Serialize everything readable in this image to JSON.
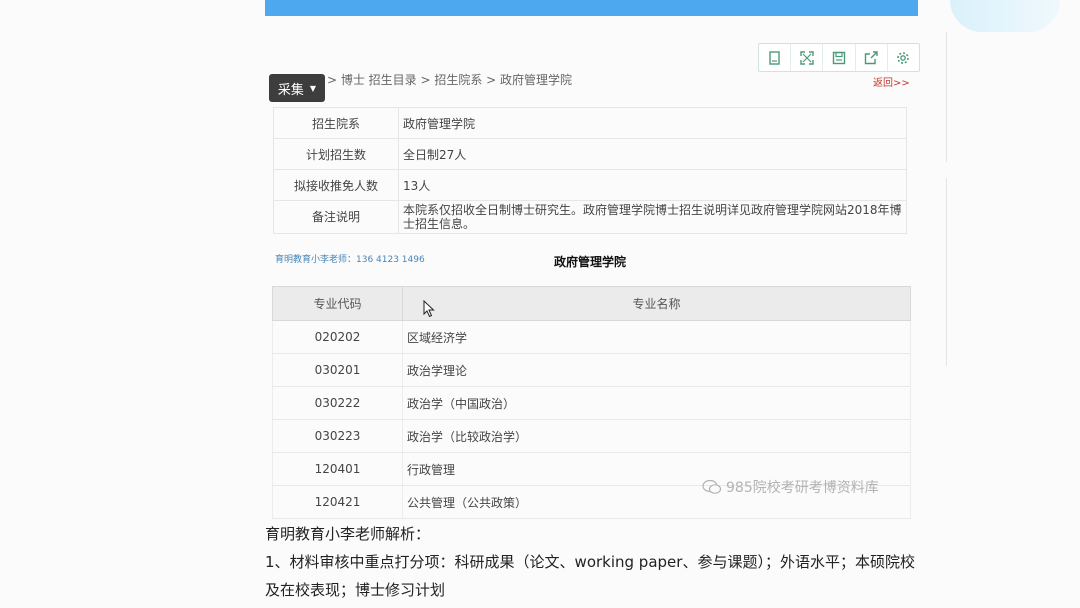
{
  "toolbar": {
    "icons": [
      "bookmark-icon",
      "fullscreen-icon",
      "save-icon",
      "share-icon",
      "gear-icon"
    ]
  },
  "collect_button": {
    "label": "采集"
  },
  "breadcrumb": "> 博士 招生目录 > 招生院系 >  政府管理学院",
  "return_link": "返回>>",
  "info_table": [
    {
      "label": "招生院系",
      "value": "政府管理学院"
    },
    {
      "label": "计划招生数",
      "value": "全日制27人"
    },
    {
      "label": "拟接收推免人数",
      "value": "13人"
    },
    {
      "label": "备注说明",
      "value": "本院系仅招收全日制博士研究生。政府管理学院博士招生说明详见政府管理学院网站2018年博士招生信息。"
    }
  ],
  "watermark_left": "育明教育小李老师：136 4123 1496",
  "section_title": "政府管理学院",
  "major_table": {
    "headers": {
      "code": "专业代码",
      "name": "专业名称"
    },
    "rows": [
      {
        "code": "020202",
        "name": "区域经济学"
      },
      {
        "code": "030201",
        "name": "政治学理论"
      },
      {
        "code": "030222",
        "name": "政治学（中国政治）"
      },
      {
        "code": "030223",
        "name": "政治学（比较政治学）"
      },
      {
        "code": "120401",
        "name": "行政管理"
      },
      {
        "code": "120421",
        "name": "公共管理（公共政策）"
      }
    ]
  },
  "watermark_right": "985院校考研考博资料库",
  "analysis": {
    "title": "育明教育小李老师解析：",
    "body": "1、材料审核中重点打分项：科研成果（论文、working paper、参与课题）；外语水平；本硕院校及在校表现；博士修习计划"
  }
}
